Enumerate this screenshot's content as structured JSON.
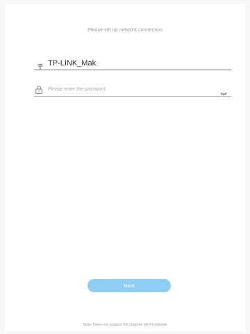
{
  "header": {
    "title": "Please set up network connection"
  },
  "network": {
    "ssid": "TP-LINK_Mak",
    "ssid_icon": "wifi-icon"
  },
  "password": {
    "placeholder": "Please enter the password",
    "value": "",
    "lock_icon": "lock-icon",
    "toggle_icon": "eye-closed-icon"
  },
  "actions": {
    "next_label": "Next"
  },
  "footer": {
    "note": "Note: Does not support 5G channel Wi-Fi network"
  },
  "colors": {
    "accent_button": "#8fcdf3",
    "background": "#f7f7f7",
    "panel": "#ffffff"
  }
}
